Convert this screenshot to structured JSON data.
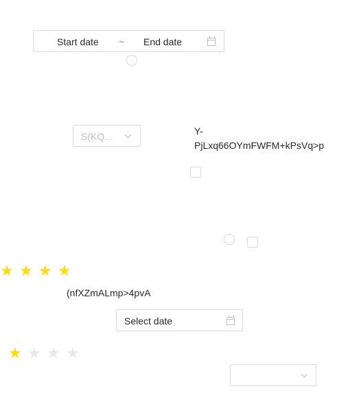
{
  "range_picker": {
    "start_placeholder": "Start date",
    "separator": "~",
    "end_placeholder": "End date",
    "icon": "calendar-icon"
  },
  "select_1": {
    "value": "S(KQ...",
    "icon": "chevron-down-icon"
  },
  "text_1": {
    "line1": "Y-",
    "line2": "PjLxq66OYmFWFM+kPsVq>p"
  },
  "label_2": {
    "text": "(nfXZmALmp>4pvA"
  },
  "date_picker": {
    "placeholder": "Select date",
    "icon": "calendar-icon"
  },
  "rating_1": {
    "value": 4,
    "max": 4
  },
  "rating_2": {
    "value": 1,
    "max": 4
  },
  "colors": {
    "star_on": "#fadb14",
    "star_off": "#e8e8e8",
    "border": "#d9d9d9"
  },
  "select_2": {
    "value": "",
    "icon": "chevron-down-icon"
  }
}
